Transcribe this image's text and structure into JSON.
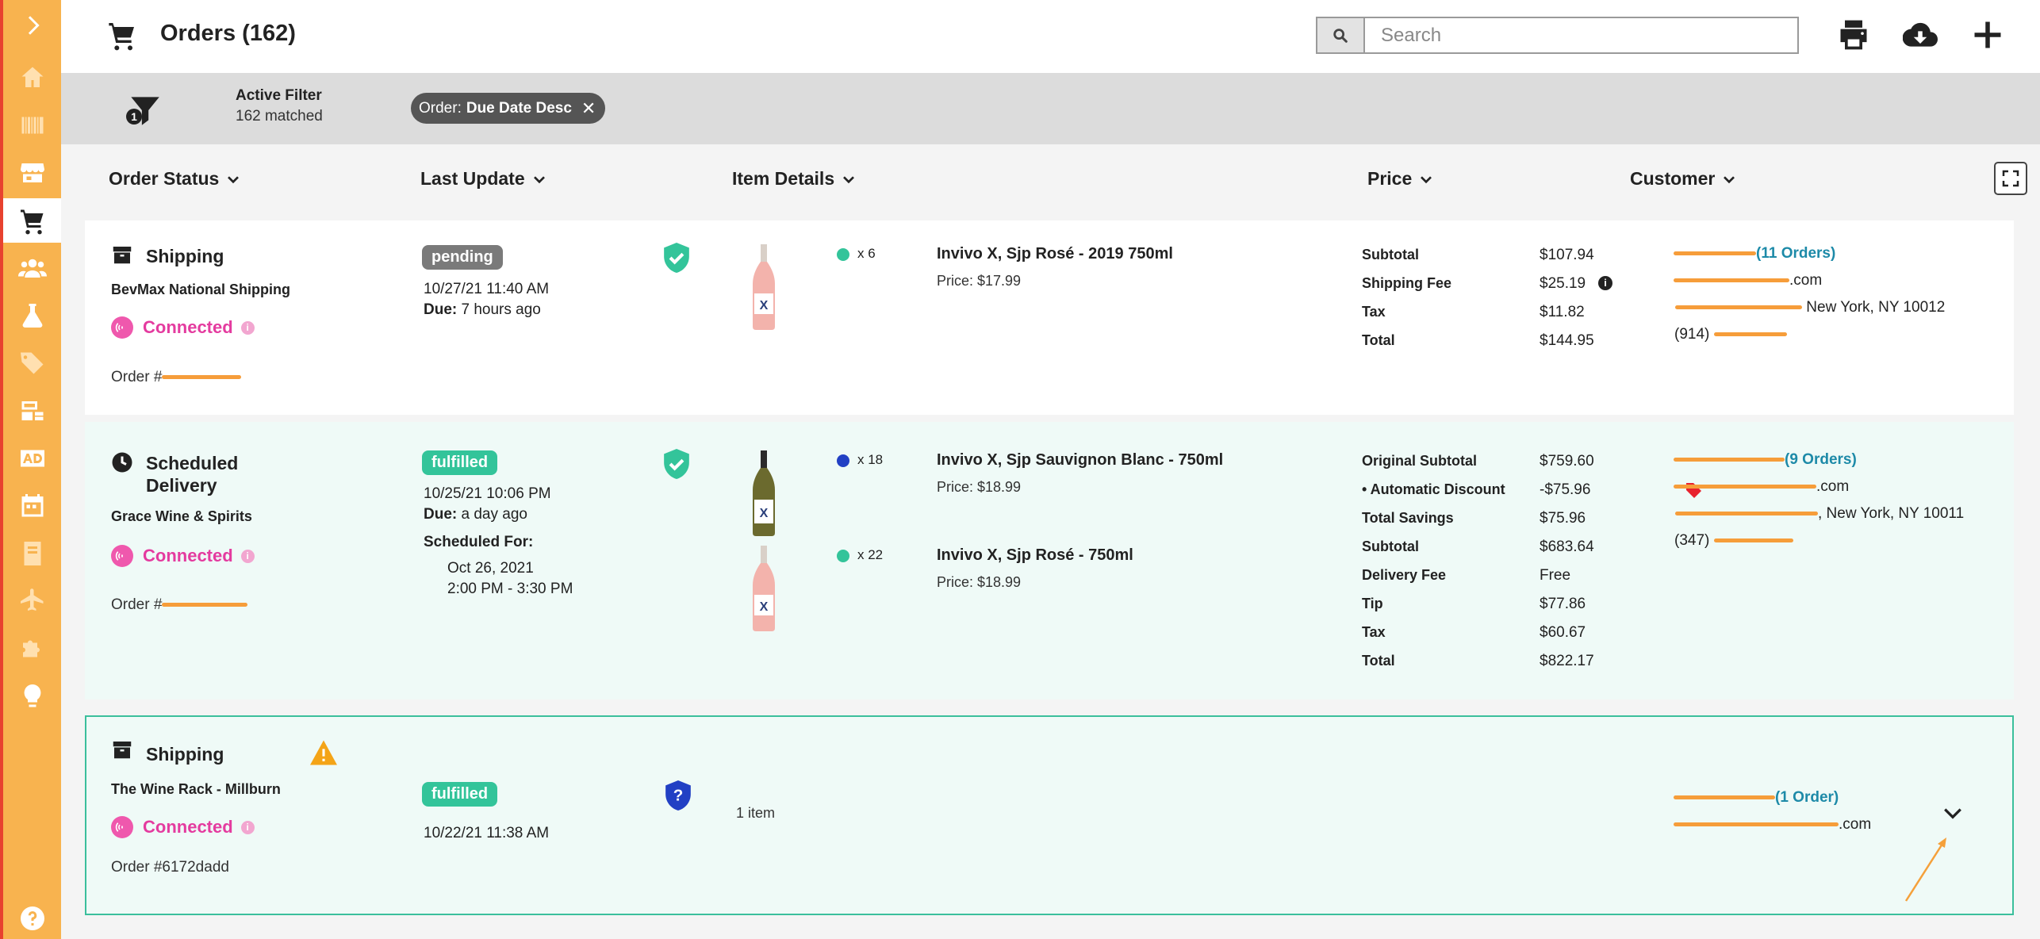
{
  "sidebar": {
    "items": [
      {
        "icon": "chevron-right-icon"
      },
      {
        "icon": "home-icon"
      },
      {
        "icon": "barcode-icon"
      },
      {
        "icon": "store-icon"
      },
      {
        "icon": "cart-icon",
        "active": true
      },
      {
        "icon": "users-icon"
      },
      {
        "icon": "flask-icon"
      },
      {
        "icon": "tags-icon"
      },
      {
        "icon": "inventory-icon"
      },
      {
        "icon": "ad-icon"
      },
      {
        "icon": "calendar-icon"
      },
      {
        "icon": "book-icon"
      },
      {
        "icon": "plane-icon"
      },
      {
        "icon": "puzzle-icon"
      },
      {
        "icon": "lightbulb-icon"
      },
      {
        "icon": "help-icon"
      }
    ]
  },
  "header": {
    "title": "Orders (162)",
    "search_placeholder": "Search",
    "actions": [
      "print-icon",
      "cloud-download-icon",
      "plus-icon"
    ]
  },
  "filter": {
    "count": "1",
    "title": "Active Filter",
    "matched": "162 matched",
    "chip_prefix": "Order:",
    "chip_value": "Due Date Desc",
    "chip_close": "✕"
  },
  "columns": {
    "status": "Order Status",
    "update": "Last Update",
    "items": "Item Details",
    "price": "Price",
    "customer": "Customer"
  },
  "orders": [
    {
      "type": "Shipping",
      "store": "BevMax National Shipping",
      "connected": "Connected",
      "order_prefix": "Order #",
      "status": "pending",
      "updated": "10/27/21 11:40 AM",
      "due_label": "Due:",
      "due": "7 hours ago",
      "items": [
        {
          "dot_color": "#33c49a",
          "qty": "x 6",
          "name": "Invivo X, Sjp Rosé - 2019 750ml",
          "price": "Price: $17.99"
        }
      ],
      "prices": [
        {
          "label": "Subtotal",
          "value": "$107.94"
        },
        {
          "label": "Shipping Fee",
          "value": "$25.19"
        },
        {
          "label": "Tax",
          "value": "$11.82"
        },
        {
          "label": "Total",
          "value": "$144.95"
        }
      ],
      "customer": {
        "orders_link": "(11 Orders)",
        "email_suffix": ".com",
        "address_suffix": "New York, NY 10012",
        "phone_prefix": "(914)"
      }
    },
    {
      "type": "Scheduled Delivery",
      "store": "Grace Wine & Spirits",
      "connected": "Connected",
      "order_prefix": "Order #",
      "status": "fulfilled",
      "updated": "10/25/21 10:06 PM",
      "due_label": "Due:",
      "due": "a day ago",
      "scheduled_label": "Scheduled For:",
      "scheduled_date": "Oct 26, 2021",
      "scheduled_time": "2:00 PM - 3:30 PM",
      "items": [
        {
          "dot_color": "#2240c4",
          "qty": "x 18",
          "name": "Invivo X, Sjp Sauvignon Blanc - 750ml",
          "price": "Price: $18.99"
        },
        {
          "dot_color": "#33c49a",
          "qty": "x 22",
          "name": "Invivo X, Sjp Rosé - 750ml",
          "price": "Price: $18.99"
        }
      ],
      "prices": [
        {
          "label": "Original Subtotal",
          "value": "$759.60"
        },
        {
          "label": "• Automatic Discount",
          "value": "-$75.96"
        },
        {
          "label": "Total Savings",
          "value": "$75.96"
        },
        {
          "label": "Subtotal",
          "value": "$683.64"
        },
        {
          "label": "Delivery Fee",
          "value": "Free"
        },
        {
          "label": "Tip",
          "value": "$77.86"
        },
        {
          "label": "Tax",
          "value": "$60.67"
        },
        {
          "label": "Total",
          "value": "$822.17"
        }
      ],
      "customer": {
        "orders_link": "(9 Orders)",
        "email_suffix": ".com",
        "address_suffix": ", New York, NY 10011",
        "phone_prefix": "(347)"
      }
    },
    {
      "type": "Shipping",
      "store": "The Wine Rack - Millburn",
      "connected": "Connected",
      "order_number": "Order #6172dadd",
      "status": "fulfilled",
      "updated": "10/22/21 11:38 AM",
      "items_summary": "1 item",
      "customer": {
        "orders_link": "(1 Order)",
        "email_suffix": ".com"
      }
    }
  ],
  "colors": {
    "sidebar": "#f8b34f",
    "accent_pink": "#e43b9f",
    "fulfilled": "#33c49a",
    "pending": "#7a7a7a",
    "link": "#1d8aa8"
  }
}
